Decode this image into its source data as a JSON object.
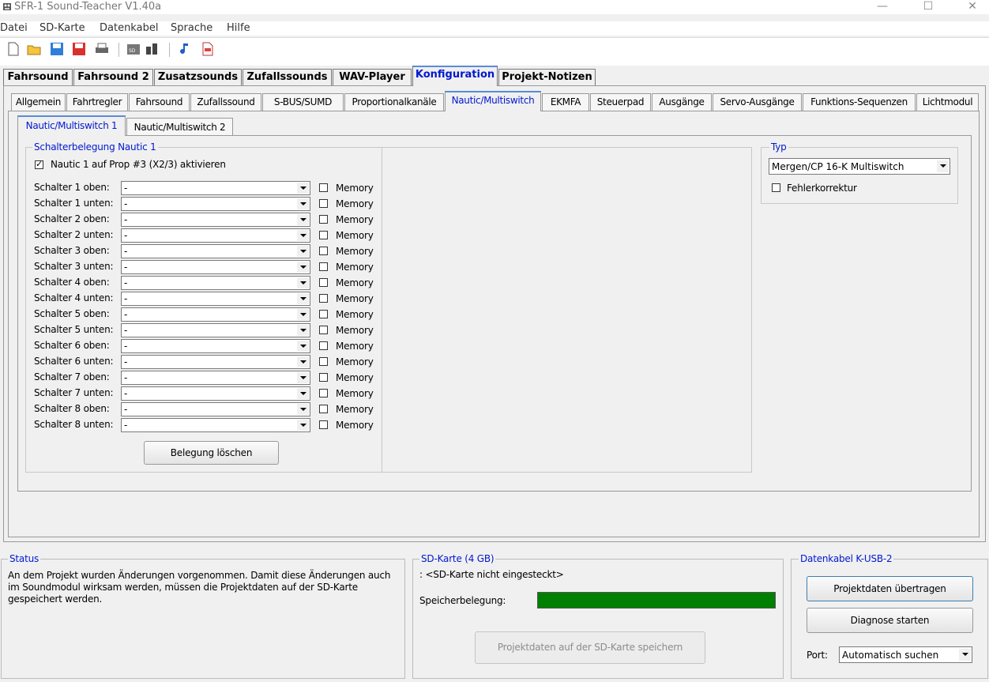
{
  "window": {
    "title": "SFR-1 Sound-Teacher V1.40a",
    "minimize_glyph": "—",
    "maximize_glyph": "☐",
    "close_glyph": "✕"
  },
  "menu": [
    "Datei",
    "SD-Karte",
    "Datenkabel",
    "Sprache",
    "Hilfe"
  ],
  "toolbar": [
    "new-icon",
    "open-icon",
    "save-icon",
    "save-as-icon",
    "print-icon",
    "sd-icon",
    "cable-icon",
    "sound-icon",
    "pdf-icon"
  ],
  "main_tabs": [
    "Fahrsound",
    "Fahrsound 2",
    "Zusatzsounds",
    "Zufallssounds",
    "WAV-Player",
    "Konfiguration",
    "Projekt-Notizen"
  ],
  "sub_tabs": [
    "Allgemein",
    "Fahrtregler",
    "Fahrsound",
    "Zufallssound",
    "S-BUS/SUMD",
    "Proportionalkanäle",
    "Nautic/Multiswitch",
    "EKMFA",
    "Steuerpad",
    "Ausgänge",
    "Servo-Ausgänge",
    "Funktions-Sequenzen",
    "Lichtmodul"
  ],
  "inner_tabs": [
    "Nautic/Multiswitch 1",
    "Nautic/Multiswitch 2"
  ],
  "nautic": {
    "group_title": "Schalterbelegung Nautic 1",
    "activate_label": "Nautic 1 auf Prop #3 (X2/3) aktivieren",
    "switches": [
      {
        "label": "Schalter 1 oben:",
        "value": "-",
        "memory": "Memory"
      },
      {
        "label": "Schalter 1 unten:",
        "value": "-",
        "memory": "Memory"
      },
      {
        "label": "Schalter 2 oben:",
        "value": "-",
        "memory": "Memory"
      },
      {
        "label": "Schalter 2 unten:",
        "value": "-",
        "memory": "Memory"
      },
      {
        "label": "Schalter 3 oben:",
        "value": "-",
        "memory": "Memory"
      },
      {
        "label": "Schalter 3 unten:",
        "value": "-",
        "memory": "Memory"
      },
      {
        "label": "Schalter 4 oben:",
        "value": "-",
        "memory": "Memory"
      },
      {
        "label": "Schalter 4 unten:",
        "value": "-",
        "memory": "Memory"
      },
      {
        "label": "Schalter 5 oben:",
        "value": "-",
        "memory": "Memory"
      },
      {
        "label": "Schalter 5 unten:",
        "value": "-",
        "memory": "Memory"
      },
      {
        "label": "Schalter 6 oben:",
        "value": "-",
        "memory": "Memory"
      },
      {
        "label": "Schalter 6 unten:",
        "value": "-",
        "memory": "Memory"
      },
      {
        "label": "Schalter 7 oben:",
        "value": "-",
        "memory": "Memory"
      },
      {
        "label": "Schalter 7 unten:",
        "value": "-",
        "memory": "Memory"
      },
      {
        "label": "Schalter 8 oben:",
        "value": "-",
        "memory": "Memory"
      },
      {
        "label": "Schalter 8 unten:",
        "value": "-",
        "memory": "Memory"
      }
    ],
    "clear_button": "Belegung löschen"
  },
  "typ": {
    "title": "Typ",
    "selected": "Mergen/CP 16-K Multiswitch",
    "error_correction": "Fehlerkorrektur"
  },
  "status": {
    "title": "Status",
    "lines": [
      "An dem Projekt wurden Änderungen vorgenommen. Damit diese Änderungen auch",
      "im Soundmodul wirksam werden, müssen die Projektdaten auf der SD-Karte",
      "gespeichert werden."
    ]
  },
  "sd": {
    "title": "SD-Karte (4 GB)",
    "state": ": <SD-Karte nicht eingesteckt>",
    "usage_label": "Speicherbelegung:",
    "usage_color": "#008000",
    "save_button": "Projektdaten auf der SD-Karte speichern"
  },
  "cable": {
    "title": "Datenkabel K-USB-2",
    "transfer_button": "Projektdaten übertragen",
    "diagnose_button": "Diagnose starten",
    "port_label": "Port:",
    "port_value": "Automatisch suchen"
  }
}
